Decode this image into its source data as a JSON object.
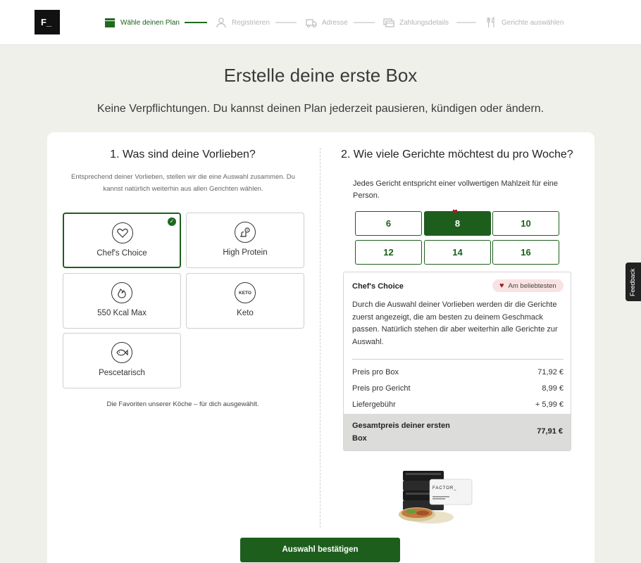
{
  "header": {
    "logo_text": "F_",
    "steps": [
      {
        "label": "Wähle deinen Plan",
        "icon": "box-icon",
        "active": true
      },
      {
        "label": "Registrieren",
        "icon": "user-icon",
        "active": false
      },
      {
        "label": "Adresse",
        "icon": "delivery-truck-icon",
        "active": false
      },
      {
        "label": "Zahlungsdetails",
        "icon": "credit-card-icon",
        "active": false
      },
      {
        "label": "Gerichte auswählen",
        "icon": "fork-knife-icon",
        "active": false
      }
    ]
  },
  "hero": {
    "title": "Erstelle deine erste Box",
    "subtitle": "Keine Verpflichtungen. Du kannst deinen Plan jederzeit pausieren, kündigen oder ändern."
  },
  "preferences": {
    "title": "1. Was sind deine Vorlieben?",
    "description": "Entsprechend deiner Vorlieben, stellen wir die eine Auswahl zusammen. Du kannst natürlich weiterhin aus allen Gerichten wählen.",
    "options": [
      {
        "label": "Chef's Choice",
        "icon": "heart-icon",
        "selected": true
      },
      {
        "label": "High Protein",
        "icon": "protein-icon",
        "selected": false
      },
      {
        "label": "550 Kcal Max",
        "icon": "flame-icon",
        "selected": false
      },
      {
        "label": "Keto",
        "icon": "keto-icon",
        "icon_text": "KETO",
        "selected": false
      },
      {
        "label": "Pescetarisch",
        "icon": "fish-icon",
        "selected": false
      }
    ],
    "footnote": "Die Favoriten unserer Köche – für dich ausgewählt."
  },
  "meals": {
    "title": "2. Wie viele Gerichte möchtest du pro Woche?",
    "description": "Jedes Gericht entspricht einer vollwertigen Mahlzeit für eine Person.",
    "options": [
      "6",
      "8",
      "10",
      "12",
      "14",
      "16"
    ],
    "selected": "8"
  },
  "summary": {
    "plan_name": "Chef's Choice",
    "badge": "Am beliebtesten",
    "text": "Durch die Auswahl deiner Vorlieben werden dir die Gerichte zuerst angezeigt, die am besten zu deinem Geschmack passen. Natürlich stehen dir aber weiterhin alle Gerichte zur Auswahl.",
    "rows": [
      {
        "label": "Preis pro Box",
        "value": "71,92 €"
      },
      {
        "label": "Preis pro Gericht",
        "value": "8,99 €"
      },
      {
        "label": "Liefergebühr",
        "value": "+ 5,99 €"
      }
    ],
    "total_label": "Gesamtpreis deiner ersten Box",
    "total_value": "77,91 €"
  },
  "product_image": {
    "brand": "FACTOR_"
  },
  "cta_label": "Auswahl bestätigen",
  "feedback_label": "Feedback",
  "colors": {
    "brand_green": "#1d5e1d",
    "heart_red": "#9e1f24",
    "background": "#f0f0eb"
  }
}
